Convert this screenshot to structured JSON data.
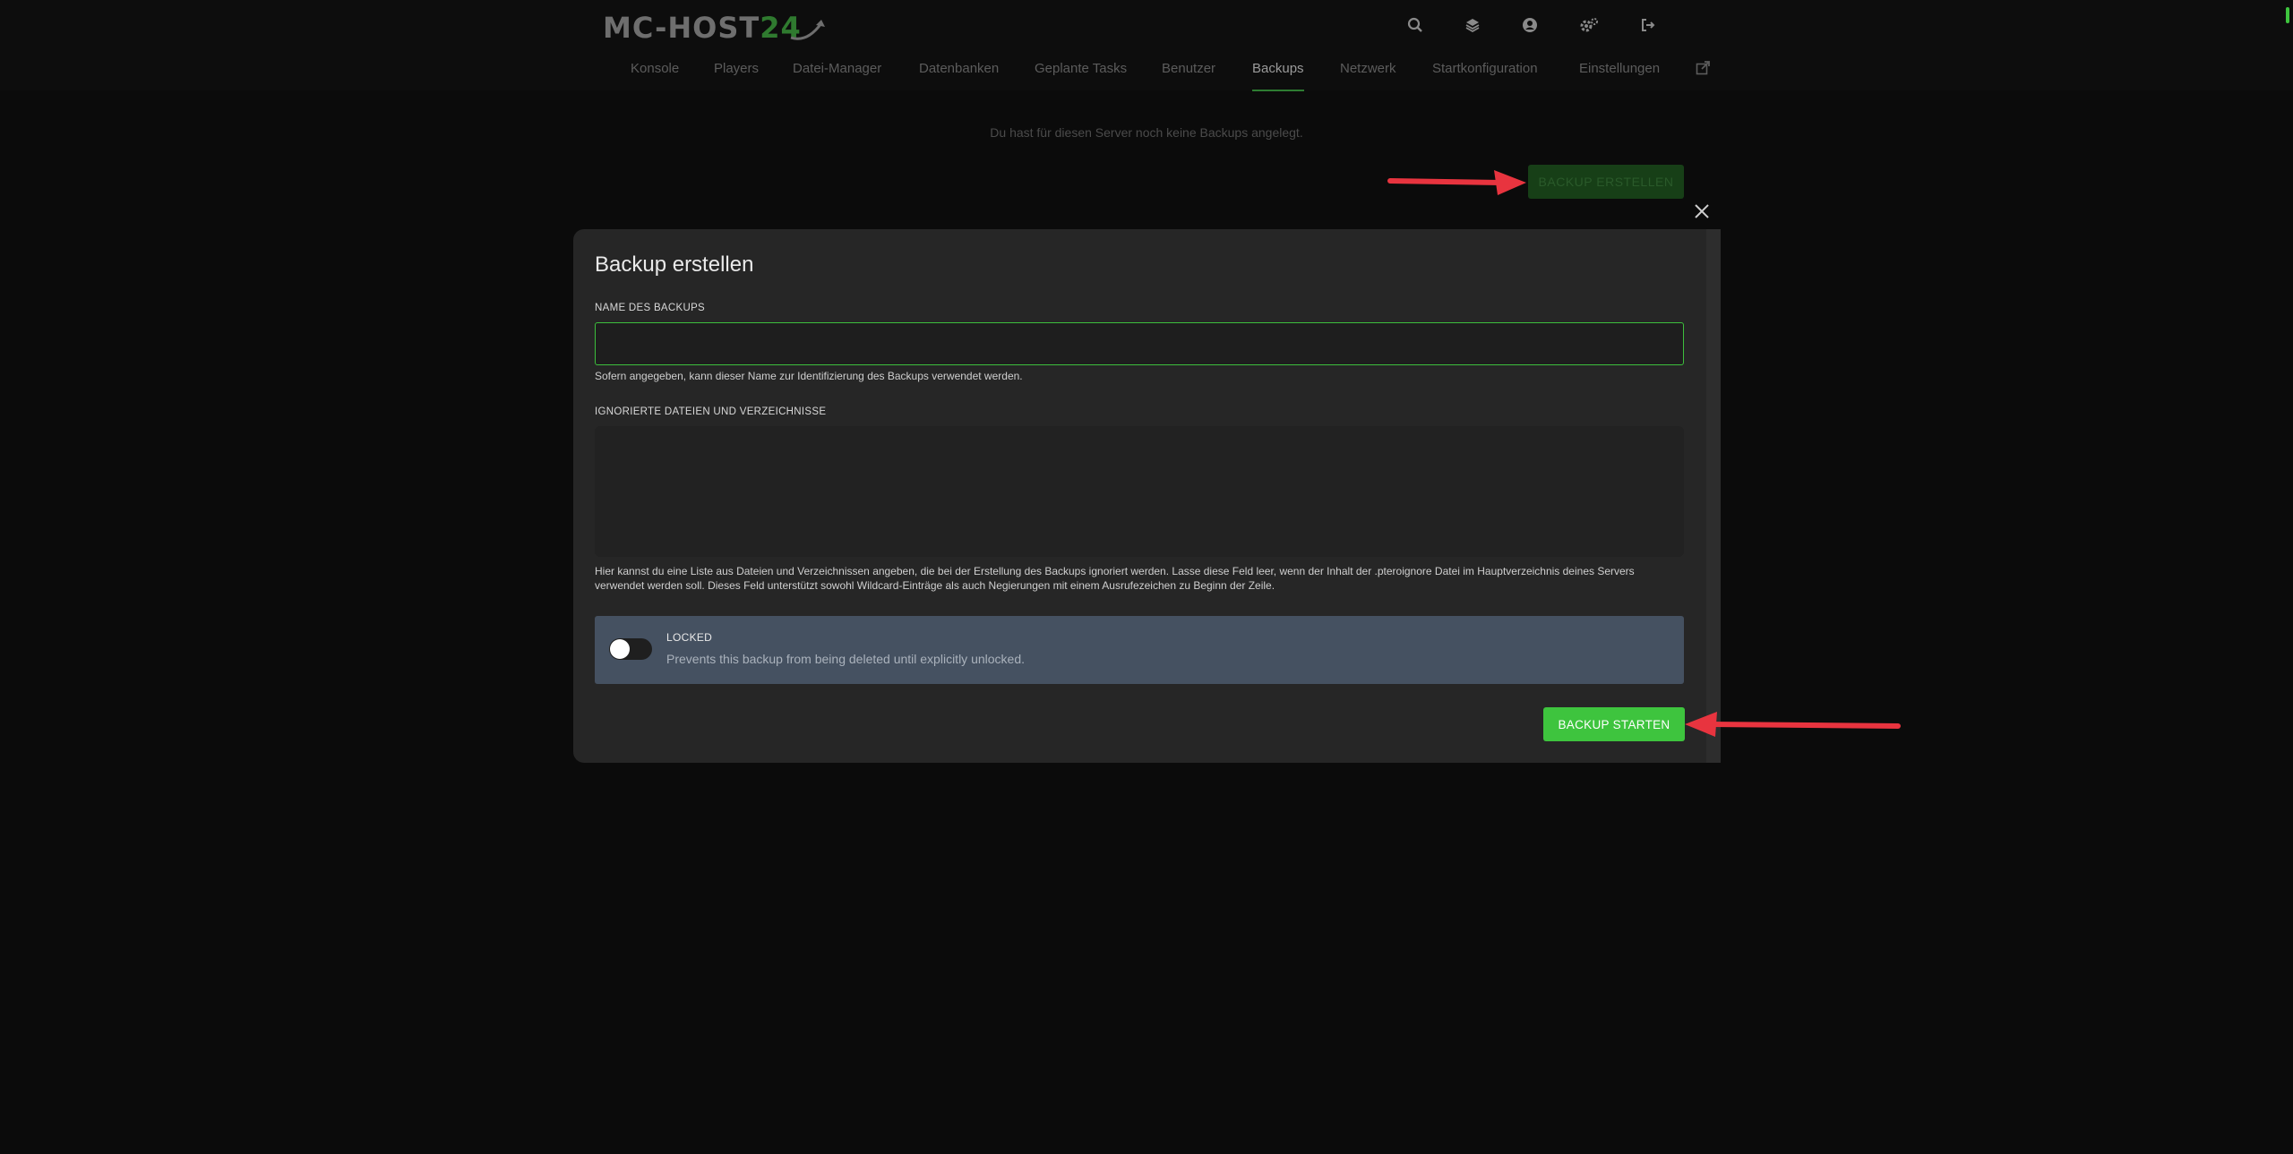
{
  "header": {
    "logo_main": "MC-HOST",
    "logo_accent": "24",
    "icons": [
      "search-icon",
      "layers-icon",
      "user-circle-icon",
      "gears-icon",
      "logout-icon"
    ]
  },
  "nav": {
    "items": [
      {
        "label": "Konsole"
      },
      {
        "label": "Players"
      },
      {
        "label": "Datei-Manager"
      },
      {
        "label": "Datenbanken"
      },
      {
        "label": "Geplante Tasks"
      },
      {
        "label": "Benutzer"
      },
      {
        "label": "Backups"
      },
      {
        "label": "Netzwerk"
      },
      {
        "label": "Startkonfiguration"
      },
      {
        "label": "Einstellungen"
      }
    ],
    "active": "Backups",
    "external_icon": "external-link-icon"
  },
  "backups_page": {
    "empty_message": "Du hast für diesen Server noch keine Backups angelegt.",
    "create_button": "BACKUP ERSTELLEN"
  },
  "modal": {
    "title": "Backup erstellen",
    "name_label": "NAME DES BACKUPS",
    "name_value": "",
    "name_hint": "Sofern angegeben, kann dieser Name zur Identifizierung des Backups verwendet werden.",
    "ignored_label": "IGNORIERTE DATEIEN UND VERZEICHNISSE",
    "ignored_value": "",
    "ignored_hint": "Hier kannst du eine Liste aus Dateien und Verzeichnissen angeben, die bei der Erstellung des Backups ignoriert werden. Lasse diese Feld leer, wenn der Inhalt der .pteroignore Datei im Hauptverzeichnis deines Servers verwendet werden soll. Dieses Feld unterstützt sowohl Wildcard-Einträge als auch Negierungen mit einem Ausrufezeichen zu Beginn der Zeile.",
    "locked_label": "LOCKED",
    "locked_desc": "Prevents this backup from being deleted until explicitly unlocked.",
    "locked_on": false,
    "submit_button": "BACKUP STARTEN"
  },
  "colors": {
    "accent": "#3ec43e",
    "annotation_arrow": "#e8343f"
  }
}
